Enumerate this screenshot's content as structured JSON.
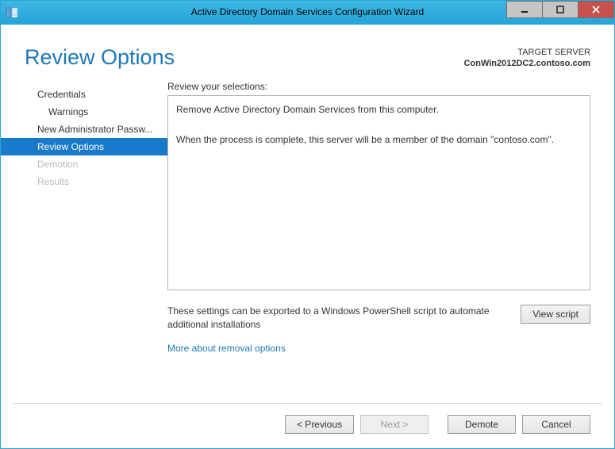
{
  "titlebar": {
    "title": "Active Directory Domain Services Configuration Wizard"
  },
  "header": {
    "page_title": "Review Options",
    "target_label": "TARGET SERVER",
    "target_value": "ConWin2012DC2.contoso.com"
  },
  "sidebar": {
    "items": [
      {
        "label": "Credentials",
        "level": 1,
        "state": "normal"
      },
      {
        "label": "Warnings",
        "level": 2,
        "state": "normal"
      },
      {
        "label": "New Administrator Passw...",
        "level": 1,
        "state": "normal"
      },
      {
        "label": "Review Options",
        "level": 1,
        "state": "selected"
      },
      {
        "label": "Demotion",
        "level": 1,
        "state": "disabled"
      },
      {
        "label": "Results",
        "level": 1,
        "state": "disabled"
      }
    ]
  },
  "main": {
    "review_label": "Review your selections:",
    "review_text": "Remove Active Directory Domain Services from this computer.\n\nWhen the process is complete, this server will be a member of the domain \"contoso.com\".",
    "export_text": "These settings can be exported to a Windows PowerShell script to automate additional installations",
    "view_script_label": "View script",
    "more_link": "More about removal options"
  },
  "footer": {
    "previous": "< Previous",
    "next": "Next >",
    "demote": "Demote",
    "cancel": "Cancel"
  }
}
